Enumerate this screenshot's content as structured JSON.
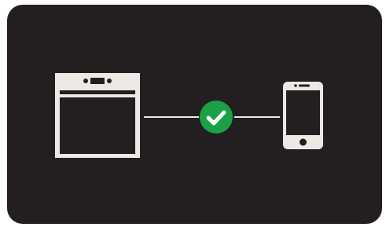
{
  "screen": {
    "background_color": "#231f20",
    "page_background": "#ffffff"
  },
  "devices": {
    "source": {
      "icon": "oven-icon",
      "color": "#ece9e4"
    },
    "target": {
      "icon": "smartphone-icon",
      "color": "#ece9e4"
    }
  },
  "connection": {
    "status": "connected",
    "status_icon": "check-circle-icon",
    "status_color": "#1aa148",
    "line_color": "#ece9e4"
  }
}
